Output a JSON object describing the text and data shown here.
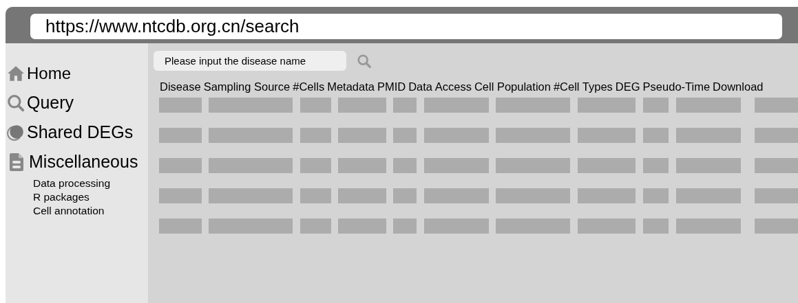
{
  "browser": {
    "url": "https://www.ntcdb.org.cn/search"
  },
  "sidebar": {
    "items": [
      {
        "kind": "home",
        "label": "Home"
      },
      {
        "kind": "search",
        "label": "Query"
      },
      {
        "kind": "shared",
        "label": "Shared DEGs"
      },
      {
        "kind": "document",
        "label": "Miscellaneous",
        "children": [
          {
            "label": "Data processing"
          },
          {
            "label": "R packages"
          },
          {
            "label": "Cell annotation"
          }
        ]
      }
    ]
  },
  "search": {
    "placeholder": "Please input the disease name"
  },
  "table": {
    "columns": [
      "Disease",
      "Sampling Source",
      "#Cells",
      "Metadata",
      "PMID",
      "Data Access",
      "Cell Population",
      "#Cell Types",
      "DEG",
      "Pseudo-Time",
      "Download"
    ],
    "rows": [
      {
        "kind": "placeholder"
      },
      {
        "kind": "placeholder"
      },
      {
        "kind": "placeholder"
      },
      {
        "kind": "placeholder"
      },
      {
        "kind": "placeholder"
      }
    ]
  }
}
